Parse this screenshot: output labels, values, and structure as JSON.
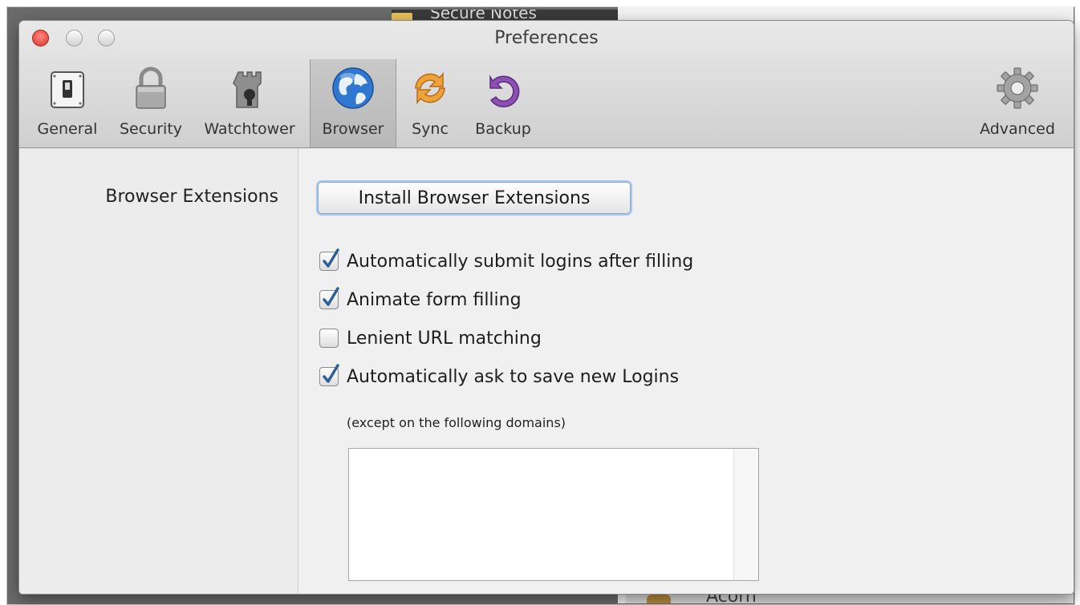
{
  "background": {
    "note_title": "Secure Notes",
    "bottom_text": "Acorn"
  },
  "window": {
    "title": "Preferences"
  },
  "toolbar": {
    "tabs": [
      {
        "label": "General",
        "icon": "switch-icon"
      },
      {
        "label": "Security",
        "icon": "padlock-icon"
      },
      {
        "label": "Watchtower",
        "icon": "tower-icon"
      },
      {
        "label": "Browser",
        "icon": "globe-icon",
        "selected": true
      },
      {
        "label": "Sync",
        "icon": "sync-icon"
      },
      {
        "label": "Backup",
        "icon": "backup-icon"
      },
      {
        "label": "Advanced",
        "icon": "gear-icon"
      }
    ]
  },
  "browser_pane": {
    "section_label": "Browser Extensions",
    "install_button": "Install Browser Extensions",
    "options": [
      {
        "label": "Automatically submit logins after filling",
        "checked": true
      },
      {
        "label": "Animate form filling",
        "checked": true
      },
      {
        "label": "Lenient URL matching",
        "checked": false
      },
      {
        "label": "Automatically ask to save new Logins",
        "checked": true
      }
    ],
    "except_note": "(except on the following domains)",
    "excluded_domains": []
  },
  "colors": {
    "close_button": "#d9312a",
    "focus_ring": "#a9c6ee",
    "checkmark": "#2f5f98"
  }
}
